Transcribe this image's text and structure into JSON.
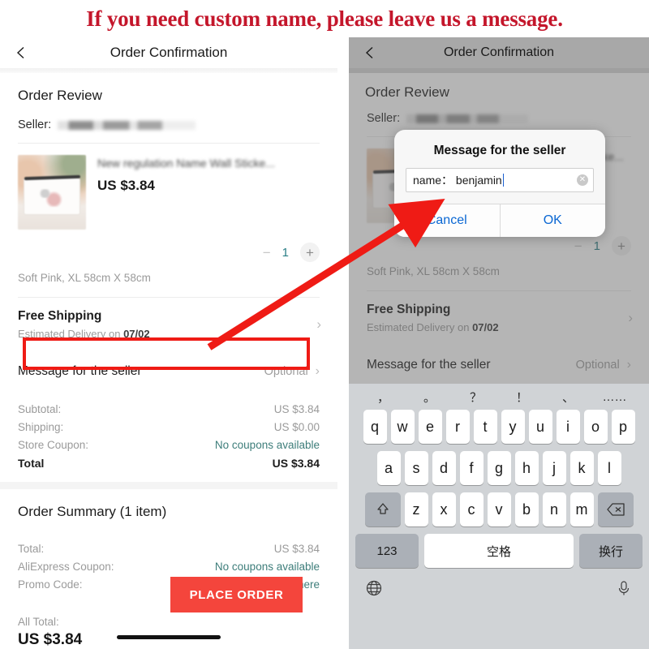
{
  "banner": {
    "text": "If you need custom name, please leave us a message."
  },
  "nav": {
    "title": "Order Confirmation",
    "back_icon": "chevron-left-icon"
  },
  "order_review": {
    "heading": "Order Review",
    "seller_label": "Seller:",
    "seller_name_blurred": "",
    "product": {
      "name": "New regulation Name Wall Sticke...",
      "price": "US $3.84",
      "quantity": "1",
      "minus": "−",
      "plus": "+",
      "variant": "Soft Pink, XL 58cm X 58cm"
    }
  },
  "shipping": {
    "title": "Free Shipping",
    "subtitle_prefix": "Estimated Delivery on ",
    "date": "07/02",
    "chevron": "›"
  },
  "message_row": {
    "label": "Message for the seller",
    "value": "Optional",
    "chevron": "›"
  },
  "totals": [
    {
      "label": "Subtotal:",
      "value": "US $3.84",
      "link": false,
      "bold": false
    },
    {
      "label": "Shipping:",
      "value": "US $0.00",
      "link": false,
      "bold": false
    },
    {
      "label": "Store Coupon:",
      "value": "No coupons available",
      "link": true,
      "bold": false
    },
    {
      "label": "Total",
      "value": "US $3.84",
      "link": false,
      "bold": true
    }
  ],
  "summary": {
    "heading": "Order Summary (1 item)",
    "rows": [
      {
        "label": "Total:",
        "value": "US $3.84",
        "link": false
      },
      {
        "label": "AliExpress Coupon:",
        "value": "No coupons available",
        "link": true
      },
      {
        "label": "Promo Code:",
        "value": "Enter code here",
        "link": true
      }
    ],
    "all_total_label": "All Total:",
    "all_total_value": "US $3.84"
  },
  "place_order_button": "PLACE ORDER",
  "dialog": {
    "title": "Message for the seller",
    "input_value": "name： benjamin",
    "clear_icon": "✕",
    "cancel_label": "Cancel",
    "ok_label": "OK"
  },
  "keyboard": {
    "punctuation": [
      "，",
      "。",
      "？",
      "！",
      "、",
      "……"
    ],
    "row1": [
      "q",
      "w",
      "e",
      "r",
      "t",
      "y",
      "u",
      "i",
      "o",
      "p"
    ],
    "row2": [
      "a",
      "s",
      "d",
      "f",
      "g",
      "h",
      "j",
      "k",
      "l"
    ],
    "row3": [
      "z",
      "x",
      "c",
      "v",
      "b",
      "n",
      "m"
    ],
    "shift_icon": "shift-icon",
    "backspace_icon": "backspace-icon",
    "numbers_key": "123",
    "space_key": "空格",
    "return_key": "换行",
    "globe_icon": "globe-icon",
    "mic_icon": "microphone-icon"
  },
  "colors": {
    "banner_red": "#c4162b",
    "highlight_red": "#ef1b15",
    "button_red": "#f4453c",
    "link_teal": "#3d7d7a",
    "dialog_blue": "#0a67d3"
  }
}
